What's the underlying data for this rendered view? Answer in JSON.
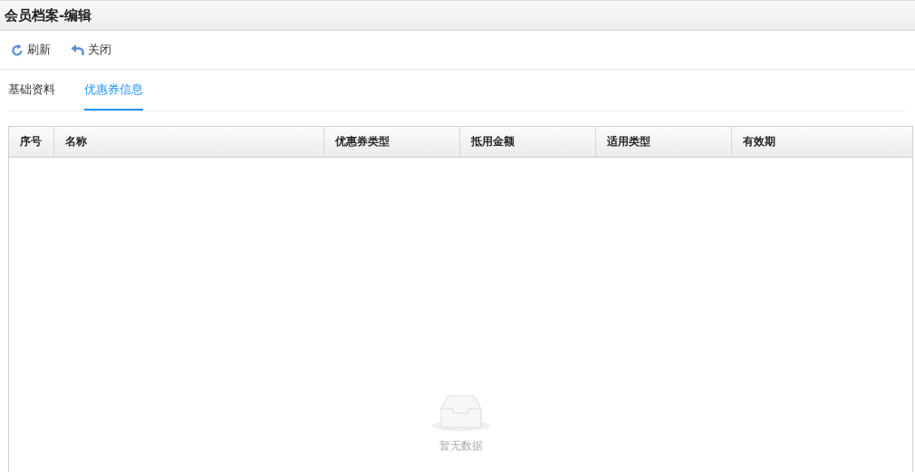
{
  "window": {
    "title": "会员档案-编辑"
  },
  "toolbar": [
    {
      "label": "刷新",
      "kind": "refresh"
    },
    {
      "label": "关闭",
      "kind": "close"
    }
  ],
  "tabs": [
    {
      "label": "基础资料",
      "selected": false
    },
    {
      "label": "优惠券信息",
      "selected": true
    }
  ],
  "table": {
    "columns": [
      "序号",
      "名称",
      "优惠券类型",
      "抵用金额",
      "适用类型",
      "有效期"
    ],
    "empty_text": "暂无数据"
  }
}
